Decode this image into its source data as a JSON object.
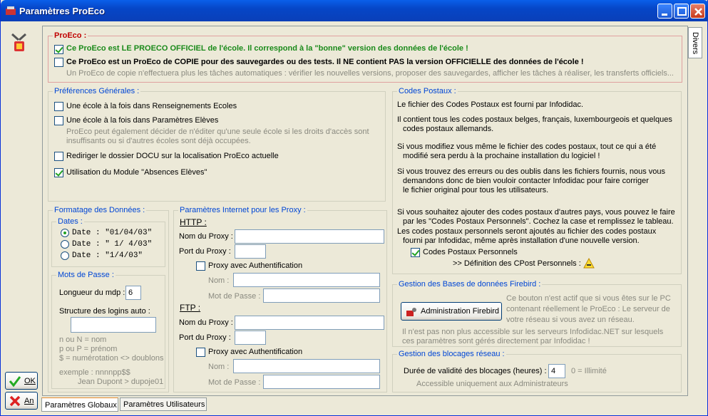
{
  "window": {
    "title": "Paramètres ProEco"
  },
  "side_tab": "Divers",
  "bottom_tabs": [
    "Paramètres Globaux",
    "Paramètres Utilisateurs"
  ],
  "buttons": {
    "ok": "OK",
    "cancel": "An"
  },
  "proeco": {
    "legend": "ProEco :",
    "official_label": "Ce ProEco est LE PROECO OFFICIEL de l'école. Il correspond à la \"bonne\" version des données de l'école !",
    "copy_label": "Ce ProEco est un ProEco de COPIE pour des sauvegardes ou des tests. Il NE contient PAS la version OFFICIELLE des données de l'école !",
    "copy_note": "Un ProEco de copie n'effectuera plus les tâches automatiques : vérifier les nouvelles versions, proposer des sauvegardes, afficher les tâches à réaliser, les transferts officiels..."
  },
  "prefs": {
    "legend": "Préférences Générales :",
    "item1": "Une école à la fois dans Renseignements Ecoles",
    "item2": "Une école à la fois dans Paramètres Elèves",
    "note1": "ProEco peut également décider de n'éditer qu'une seule école si les droits d'accès sont",
    "note2": "insuffisants ou si d'autres écoles sont déjà occupées.",
    "item3": "Rediriger le dossier DOCU sur la localisation ProEco actuelle",
    "item4": "Utilisation du Module \"Absences Elèves\""
  },
  "format": {
    "legend": "Formatage des Données :",
    "dates_legend": "Dates :",
    "dates": [
      "Date : \"01/04/03\"",
      "Date : \" 1/ 4/03\"",
      "Date : \"1/4/03\""
    ],
    "pwd_legend": "Mots de Passe :",
    "mdp_label": "Longueur du mdp :",
    "mdp_value": "6",
    "logins_label": "Structure des logins auto :",
    "logins_value": "",
    "hints": [
      "n ou N = nom",
      "p ou P = prénom",
      "$ = numérotation  <> doublons"
    ],
    "example1": "exemple : nnnnpp$$",
    "example2": "Jean Dupont > dupoje01"
  },
  "proxy": {
    "legend": "Paramètres Internet pour les Proxy :",
    "http": "HTTP :",
    "ftp": "FTP :",
    "name_label": "Nom du Proxy :",
    "port_label": "Port du Proxy :",
    "auth_label": "Proxy avec Authentification",
    "nom_label": "Nom :",
    "pwd_label": "Mot de Passe :"
  },
  "postal": {
    "legend": "Codes Postaux :",
    "p1": "Le fichier des Codes Postaux est fourni par Infodidac.",
    "p2a": "Il contient tous les codes postaux belges, français, luxembourgeois et quelques",
    "p2b": "codes postaux allemands.",
    "p3a": "Si vous modifiez vous même le fichier des codes postaux, tout ce qui a été",
    "p3b": "modifié sera perdu à la prochaine installation du logiciel !",
    "p4a": "Si vous trouvez des erreurs ou des oublis dans les fichiers fournis, nous vous",
    "p4b": "demandons donc de bien vouloir contacter Infodidac pour faire corriger",
    "p4c": "le fichier original pour tous les utilisateurs.",
    "p5a": "Si vous souhaitez ajouter des codes postaux d'autres pays, vous pouvez le faire",
    "p5b": "par les \"Codes Postaux Personnels\". Cochez la case et remplissez le tableau.",
    "p6a": "Les codes postaux personnels seront ajoutés au fichier des codes postaux",
    "p6b": "fourni par Infodidac, même après installation d'une nouvelle version.",
    "personal_label": "Codes Postaux Personnels",
    "definition_label": ">> Définition des CPost Personnels :"
  },
  "firebird": {
    "legend": "Gestion des Bases de données Firebird :",
    "button": "Administration Firebird",
    "n1": "Ce bouton n'est actif que si vous êtes sur le PC",
    "n2": "contenant réellement le ProEco : Le serveur de",
    "n3": "votre réseau si vous avez un réseau.",
    "n4": "Il n'est pas non plus accessible sur les serveurs Infodidac.NET sur lesquels",
    "n5": "ces paramètres sont gérés directement par Infodidac !"
  },
  "locks": {
    "legend": "Gestion des blocages réseau :",
    "label": "Durée de validité des blocages (heures) :",
    "value": "4",
    "unit": "0 = Illimité",
    "note": "Accessible uniquement aux Administrateurs"
  }
}
